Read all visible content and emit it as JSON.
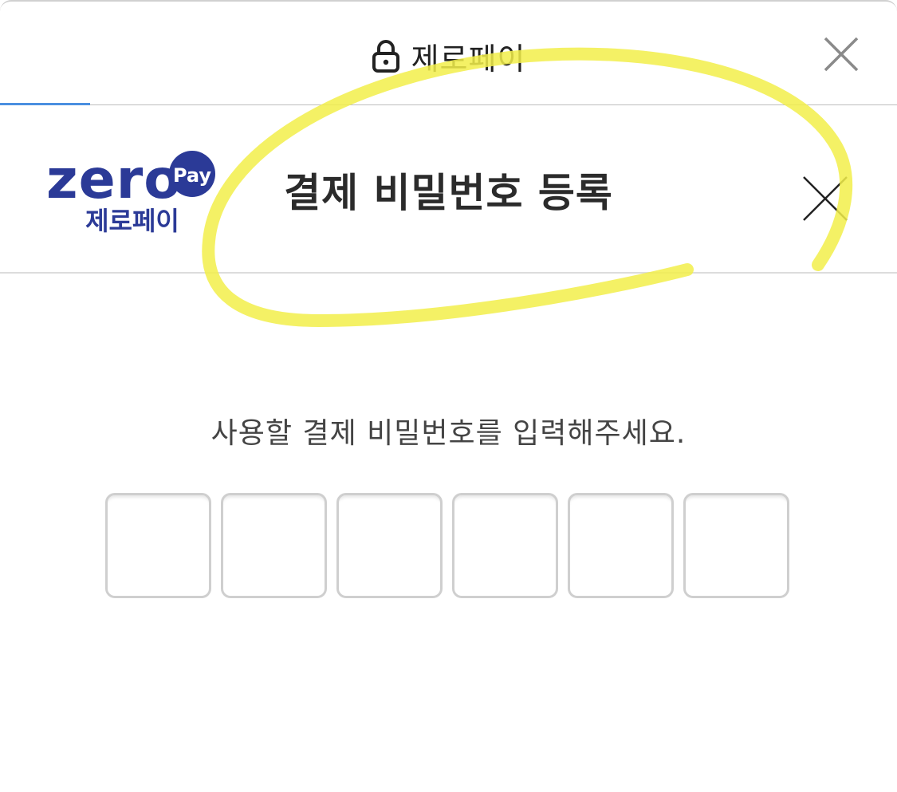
{
  "topbar": {
    "site_title": "제로페이",
    "lock_icon": "lock-icon",
    "close_icon": "close-icon"
  },
  "header": {
    "logo_text_primary": "zero",
    "logo_text_badge": "Pay",
    "logo_text_korean": "제로페이",
    "title": "결제 비밀번호 등록",
    "close_icon": "close-icon"
  },
  "main": {
    "instruction": "사용할 결제 비밀번호를 입력해주세요.",
    "pin_digits": [
      "",
      "",
      "",
      "",
      "",
      ""
    ]
  },
  "colors": {
    "brand_navy": "#2b3a97",
    "progress_blue": "#4a8fe0",
    "highlight_yellow": "#f2ee4a",
    "title_text": "#2b2b2b",
    "box_border": "#cfcfcf"
  },
  "progress": {
    "loaded_fraction": 0.1
  }
}
